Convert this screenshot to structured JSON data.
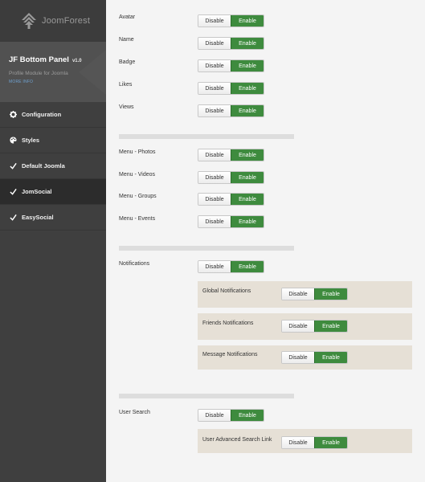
{
  "brand": {
    "name": "JoomForest",
    "logo_icon": "joomforest-tree-icon"
  },
  "module": {
    "title": "JF Bottom Panel",
    "version": "v1.0",
    "subtitle": "Profile Module for Joomla",
    "more_info": "MORE INFO"
  },
  "nav": [
    {
      "label": "Configuration",
      "icon": "gear-icon"
    },
    {
      "label": "Styles",
      "icon": "palette-icon"
    },
    {
      "label": "Default Joomla",
      "icon": "check-icon"
    },
    {
      "label": "JomSocial",
      "icon": "check-icon",
      "active": true
    },
    {
      "label": "EasySocial",
      "icon": "check-icon"
    }
  ],
  "toggle": {
    "disable": "Disable",
    "enable": "Enable"
  },
  "settings": {
    "avatar": "Avatar",
    "name": "Name",
    "badge": "Badge",
    "likes": "Likes",
    "views": "Views",
    "menu_photos": "Menu - Photos",
    "menu_videos": "Menu - Videos",
    "menu_groups": "Menu - Groups",
    "menu_events": "Menu - Events",
    "notifications": "Notifications",
    "global_notifications": "Global Notifications",
    "friends_notifications": "Friends Notifications",
    "message_notifications": "Message Notifications",
    "user_search": "User Search",
    "user_advanced_search_link": "User Advanced Search Link"
  },
  "colors": {
    "sidebar": "#3f3f3f",
    "enable": "#3e8b3e",
    "sub_panel": "#e6e0d6"
  }
}
